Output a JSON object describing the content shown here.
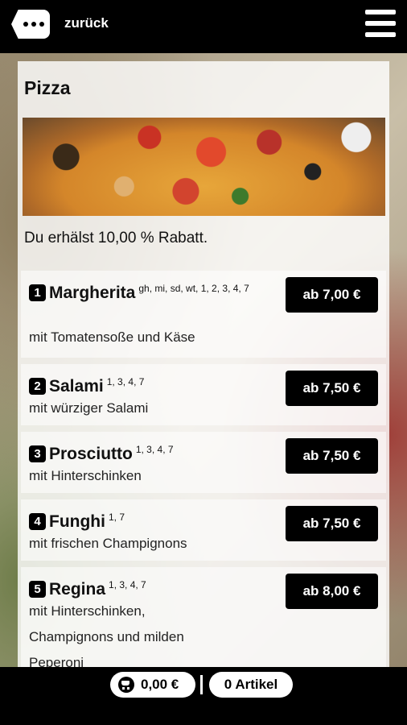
{
  "header": {
    "back_label": "zurück"
  },
  "page": {
    "title": "Pizza",
    "discount_text": "Du erhälst 10,00 % Rabatt."
  },
  "items": [
    {
      "number": "1",
      "name": "Margherita",
      "allergens": "gh, mi, sd, wt, 1, 2, 3, 4, 7",
      "description": "mit Tomatensoße und Käse",
      "price": "ab 7,00 €"
    },
    {
      "number": "2",
      "name": "Salami",
      "allergens": "1, 3, 4, 7",
      "description": "mit würziger Salami",
      "price": "ab 7,50 €"
    },
    {
      "number": "3",
      "name": "Prosciutto",
      "allergens": "1, 3, 4, 7",
      "description": "mit Hinterschinken",
      "price": "ab 7,50 €"
    },
    {
      "number": "4",
      "name": "Funghi",
      "allergens": "1, 7",
      "description": "mit frischen Champignons",
      "price": "ab 7,50 €"
    },
    {
      "number": "5",
      "name": "Regina",
      "allergens": "1, 3, 4, 7",
      "description": "mit Hinterschinken, Champignons und milden Peperoni",
      "price": "ab 8,00 €"
    }
  ],
  "cart": {
    "total": "0,00 €",
    "count_label": "0 Artikel"
  },
  "icons": {
    "back": "back-dots-icon",
    "menu": "hamburger-menu-icon",
    "cart": "cart-icon"
  }
}
